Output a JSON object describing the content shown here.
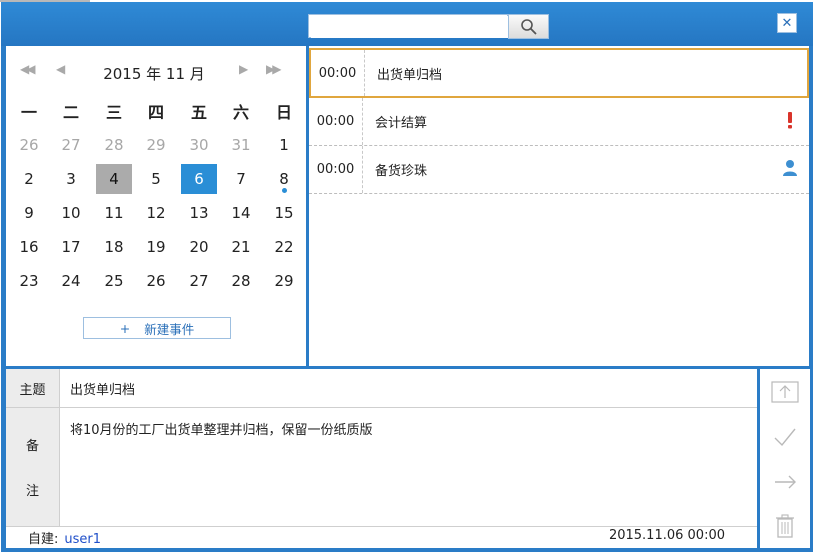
{
  "search": {
    "placeholder": "",
    "value": ""
  },
  "calendar": {
    "title": "2015 年 11 月",
    "weekdays": [
      "一",
      "二",
      "三",
      "四",
      "五",
      "六",
      "日"
    ],
    "weeks": [
      [
        "26",
        "27",
        "28",
        "29",
        "30",
        "31",
        "1"
      ],
      [
        "2",
        "3",
        "4",
        "5",
        "6",
        "7",
        "8"
      ],
      [
        "9",
        "10",
        "11",
        "12",
        "13",
        "14",
        "15"
      ],
      [
        "16",
        "17",
        "18",
        "19",
        "20",
        "21",
        "22"
      ],
      [
        "23",
        "24",
        "25",
        "26",
        "27",
        "28",
        "29"
      ]
    ],
    "new_event_label": "新建事件"
  },
  "events": [
    {
      "time": "00:00",
      "title": "出货单归档",
      "icon": ""
    },
    {
      "time": "00:00",
      "title": "会计结算",
      "icon": "exclamation-icon"
    },
    {
      "time": "00:00",
      "title": "备货珍珠",
      "icon": "user-icon"
    }
  ],
  "detail": {
    "subject_label": "主题",
    "subject_value": "出货单归档",
    "note_label_1": "备",
    "note_label_2": "注",
    "note_value": "将10月份的工厂出货单整理并归档，保留一份纸质版",
    "creator_label": "自建:",
    "creator_name": "user1",
    "datetime": "2015.11.06 00:00"
  },
  "colors": {
    "frame": "#2a7cc7",
    "accent": "#2a8ed6",
    "selected_border": "#e0a63e",
    "alert": "#d9342b"
  }
}
